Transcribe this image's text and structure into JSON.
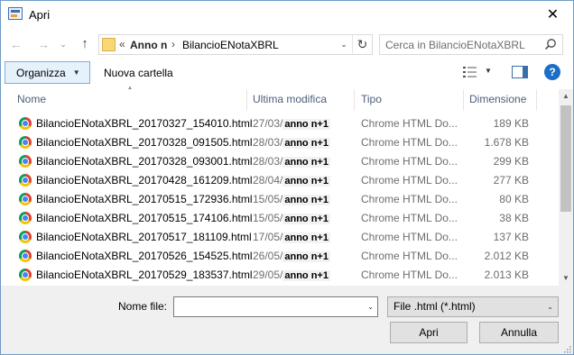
{
  "window": {
    "title": "Apri",
    "close_glyph": "✕"
  },
  "nav": {
    "back_glyph": "←",
    "forward_glyph": "→",
    "recent_glyph": "⌄",
    "up_glyph": "↑",
    "address_sep1": "«",
    "address_part1": "Anno n",
    "address_sep2": "›",
    "address_part2": "BilancioENotaXBRL",
    "address_dropdown_glyph": "⌄",
    "refresh_glyph": "↻",
    "search_placeholder": "Cerca in BilancioENotaXBRL"
  },
  "toolbar": {
    "organize_label": "Organizza",
    "organize_caret": "▼",
    "new_folder_label": "Nuova cartella",
    "view_caret": "▼",
    "help_label": "?"
  },
  "list": {
    "sort_arrow": "▲",
    "columns": {
      "name": "Nome",
      "modified": "Ultima modifica",
      "type": "Tipo",
      "size": "Dimensione"
    },
    "rows": [
      {
        "name": "BilancioENotaXBRL_20170327_154010.html",
        "date": "27/03/",
        "date_bold": "anno n+1",
        "type": "Chrome HTML Do...",
        "size": "189 KB"
      },
      {
        "name": "BilancioENotaXBRL_20170328_091505.html",
        "date": "28/03/",
        "date_bold": "anno n+1",
        "type": "Chrome HTML Do...",
        "size": "1.678 KB"
      },
      {
        "name": "BilancioENotaXBRL_20170328_093001.html",
        "date": "28/03/",
        "date_bold": "anno n+1",
        "type": "Chrome HTML Do...",
        "size": "299 KB"
      },
      {
        "name": "BilancioENotaXBRL_20170428_161209.html",
        "date": "28/04/",
        "date_bold": "anno n+1",
        "type": "Chrome HTML Do...",
        "size": "277 KB"
      },
      {
        "name": "BilancioENotaXBRL_20170515_172936.html",
        "date": "15/05/",
        "date_bold": "anno n+1",
        "type": "Chrome HTML Do...",
        "size": "80 KB"
      },
      {
        "name": "BilancioENotaXBRL_20170515_174106.html",
        "date": "15/05/",
        "date_bold": "anno n+1",
        "type": "Chrome HTML Do...",
        "size": "38 KB"
      },
      {
        "name": "BilancioENotaXBRL_20170517_181109.html",
        "date": "17/05/",
        "date_bold": "anno n+1",
        "type": "Chrome HTML Do...",
        "size": "137 KB"
      },
      {
        "name": "BilancioENotaXBRL_20170526_154525.html",
        "date": "26/05/",
        "date_bold": "anno n+1",
        "type": "Chrome HTML Do...",
        "size": "2.012 KB"
      },
      {
        "name": "BilancioENotaXBRL_20170529_183537.html",
        "date": "29/05/",
        "date_bold": "anno n+1",
        "type": "Chrome HTML Do...",
        "size": "2.013 KB"
      }
    ]
  },
  "scrollbar": {
    "up_glyph": "▲",
    "down_glyph": "▼"
  },
  "footer": {
    "filename_label": "Nome file:",
    "filename_value": "",
    "filename_caret": "⌄",
    "filetype_value": "File .html (*.html)",
    "filetype_caret": "⌄",
    "open_label": "Apri",
    "cancel_label": "Annulla"
  },
  "colors": {
    "accent": "#1c6ec7",
    "header_text": "#4c607a",
    "organize_bg": "#e5f1fb",
    "border": "#6f9bc6"
  },
  "icons": [
    "app-icon",
    "close-icon",
    "back-arrow-icon",
    "forward-arrow-icon",
    "up-arrow-icon",
    "folder-icon",
    "refresh-icon",
    "search-icon",
    "view-icon",
    "preview-pane-icon",
    "help-icon",
    "chrome-file-icon"
  ]
}
